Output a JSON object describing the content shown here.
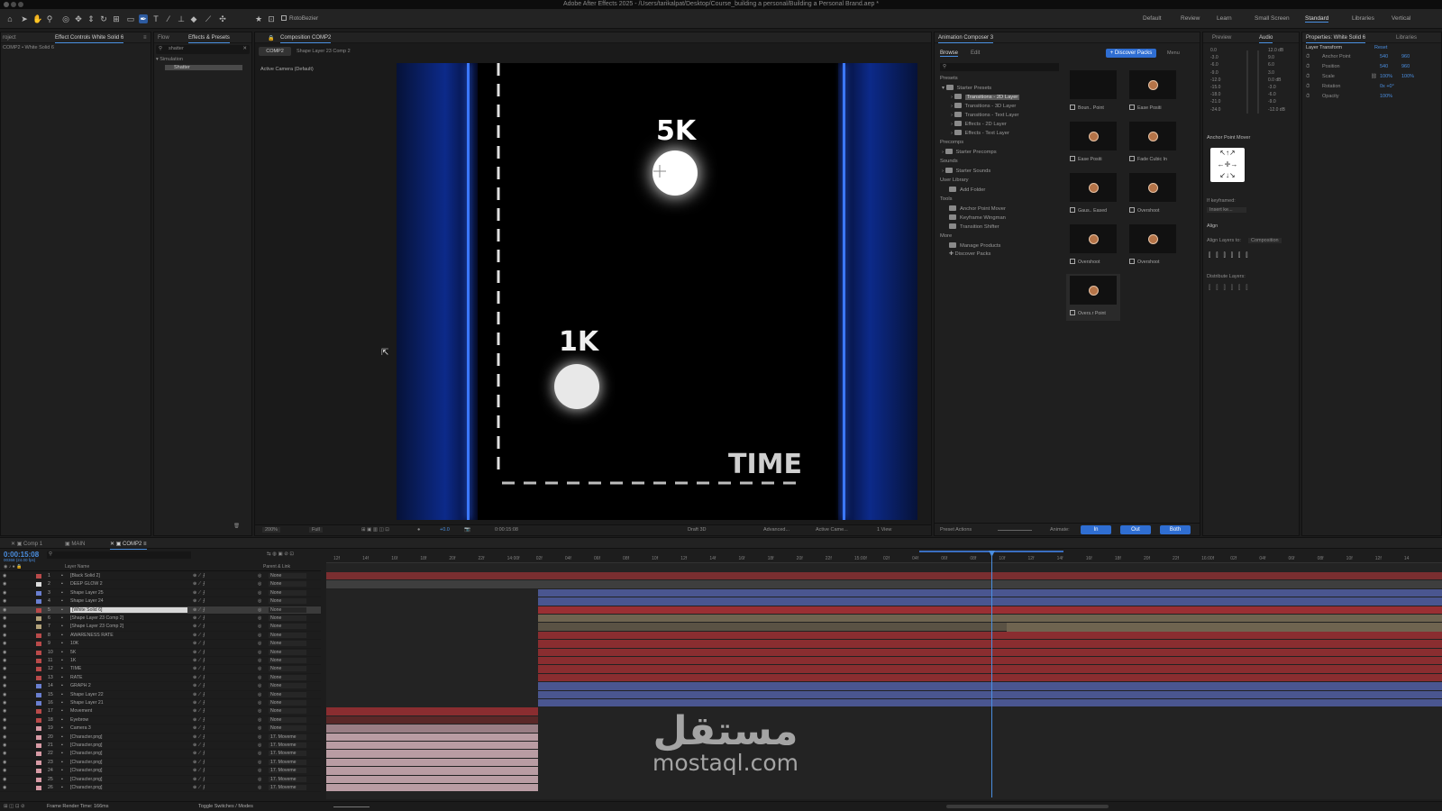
{
  "app": {
    "title": "Adobe After Effects 2025 - /Users/tarikalpat/Desktop/Course_building a personal/Building a Personal Brand.aep *"
  },
  "toolbar": {
    "rotobezier_label": "RotoBezier",
    "workspaces": [
      "Default",
      "Review",
      "Learn",
      "Small Screen",
      "Standard",
      "Libraries",
      "Vertical"
    ]
  },
  "project_panel": {
    "tab": "roject",
    "item": "COMP2 • White Solid 6"
  },
  "effect_controls": {
    "tab": "Effect Controls White Solid 6"
  },
  "effects_panel": {
    "tab_flow": "Flow",
    "tab": "Effects & Presets",
    "search": "shatter",
    "category": "Simulation",
    "result": "Shatter"
  },
  "composition": {
    "tab": "Composition COMP2",
    "breadcrumb_comp": "COMP2",
    "breadcrumb_layer": "Shape Layer 23 Comp 2",
    "camera_label": "Active Camera (Default)",
    "scene": {
      "label_top": "5K",
      "label_bottom": "1K",
      "label_axis": "TIME"
    },
    "footer": {
      "zoom": "200%",
      "resolution": "Full",
      "exposure": "+0.0",
      "timecode": "0:00:15:08",
      "renderer": "Draft 3D",
      "advanced": "Advanced...",
      "camera": "Active Came...",
      "view": "1 View"
    }
  },
  "animation_composer": {
    "title": "Animation Composer 3",
    "tab_browse": "Browse",
    "tab_edit": "Edit",
    "discover_btn": "+ Discover Packs",
    "menu": "Menu",
    "tree": [
      {
        "label": "Presets",
        "level": 0,
        "type": "header"
      },
      {
        "label": "Starter Presets",
        "level": 0,
        "type": "folder"
      },
      {
        "label": "Transitions - 2D Layer",
        "level": 1,
        "type": "folder",
        "selected": true
      },
      {
        "label": "Transitions - 3D Layer",
        "level": 1,
        "type": "folder"
      },
      {
        "label": "Transitions - Text Layer",
        "level": 1,
        "type": "folder"
      },
      {
        "label": "Effects - 2D Layer",
        "level": 1,
        "type": "folder"
      },
      {
        "label": "Effects - Text Layer",
        "level": 1,
        "type": "folder"
      },
      {
        "label": "Precomps",
        "level": 0,
        "type": "header"
      },
      {
        "label": "Starter Precomps",
        "level": 0,
        "type": "folder"
      },
      {
        "label": "Sounds",
        "level": 0,
        "type": "header"
      },
      {
        "label": "Starter Sounds",
        "level": 0,
        "type": "folder"
      },
      {
        "label": "User Library",
        "level": 0,
        "type": "header"
      },
      {
        "label": "Add Folder",
        "level": 0,
        "type": "link"
      },
      {
        "label": "Tools",
        "level": 0,
        "type": "header"
      },
      {
        "label": "Anchor Point Mover",
        "level": 0,
        "type": "link"
      },
      {
        "label": "Keyframe Wingman",
        "level": 0,
        "type": "link"
      },
      {
        "label": "Transition Shifter",
        "level": 0,
        "type": "link"
      },
      {
        "label": "More",
        "level": 0,
        "type": "header"
      },
      {
        "label": "Manage Products",
        "level": 0,
        "type": "link"
      },
      {
        "label": "Discover Packs",
        "level": 0,
        "type": "link"
      }
    ],
    "presets": [
      "Boun.. Point",
      "Ease Positi",
      "Ease Positi",
      "Fade Cubic In",
      "Gaus.. Eased",
      "Overshoot",
      "Overshoot",
      "Overshoot",
      "Overs.r Point"
    ],
    "preset_actions": "Preset Actions",
    "animate_label": "Animate:",
    "btn_in": "In",
    "btn_out": "Out",
    "btn_both": "Both"
  },
  "audio_panel": {
    "tab_preview": "Preview",
    "tab_audio": "Audio",
    "levels_left": [
      "0.0",
      "-3.0",
      "-6.0",
      "-9.0",
      "-12.0",
      "-15.0",
      "-18.0",
      "-21.0",
      "-24.0"
    ],
    "levels_right": [
      "12.0 dB",
      "9.0",
      "6.0",
      "3.0",
      "0.0 dB",
      "-3.0",
      "-6.0",
      "-9.0",
      "-12.0 dB"
    ]
  },
  "anchor_point_mover": {
    "title": "Anchor Point Mover",
    "if_keyframed": "If keyframed:",
    "insert_option": "Insert ke..."
  },
  "align_panel": {
    "title": "Align",
    "align_to_label": "Align Layers to:",
    "align_to": "Composition",
    "distribute_label": "Distribute Layers:"
  },
  "properties": {
    "title": "Properties: White Solid 6",
    "libraries_tab": "Libraries",
    "section": "Layer Transform",
    "reset": "Reset",
    "rows": [
      {
        "name": "Anchor Point",
        "v1": "540",
        "v2": "960"
      },
      {
        "name": "Position",
        "v1": "540",
        "v2": "960"
      },
      {
        "name": "Scale",
        "v1": "100%",
        "v2": "100%"
      },
      {
        "name": "Rotation",
        "v1": "0x +0°",
        "v2": ""
      },
      {
        "name": "Opacity",
        "v1": "100%",
        "v2": ""
      }
    ]
  },
  "timeline": {
    "tabs": [
      "Comp 1",
      "MAIN",
      "COMP2"
    ],
    "timecode": "0:00:15:08",
    "timecode_sub": "00368 (24.00 fps)",
    "col_layer_name": "Layer Name",
    "col_parent": "Parent & Link",
    "ruler": [
      "12f",
      "14f",
      "16f",
      "18f",
      "20f",
      "22f",
      "14:00f",
      "02f",
      "04f",
      "06f",
      "08f",
      "10f",
      "12f",
      "14f",
      "16f",
      "18f",
      "20f",
      "22f",
      "15:00f",
      "02f",
      "04f",
      "06f",
      "08f",
      "10f",
      "12f",
      "14f",
      "16f",
      "18f",
      "20f",
      "22f",
      "16:00f",
      "02f",
      "04f",
      "06f",
      "08f",
      "10f",
      "12f",
      "14"
    ],
    "layers": [
      {
        "num": "1",
        "name": "[Black Solid 2]",
        "color": "#b94a4a",
        "parent": "None"
      },
      {
        "num": "2",
        "name": "DEEP GLOW 2",
        "color": "#dddddd",
        "parent": "None"
      },
      {
        "num": "3",
        "name": "Shape Layer 25",
        "color": "#6a7fd0",
        "parent": "None"
      },
      {
        "num": "4",
        "name": "Shape Layer 24",
        "color": "#6a7fd0",
        "parent": "None"
      },
      {
        "num": "5",
        "name": "[White Solid 6]",
        "color": "#b94a4a",
        "parent": "None",
        "selected": true
      },
      {
        "num": "6",
        "name": "[Shape Layer 23 Comp 2]",
        "color": "#b3a27a",
        "parent": "None"
      },
      {
        "num": "7",
        "name": "[Shape Layer 23 Comp 2]",
        "color": "#b3a27a",
        "parent": "None"
      },
      {
        "num": "8",
        "name": "AWARENESS RATE",
        "color": "#b94a4a",
        "parent": "None"
      },
      {
        "num": "9",
        "name": "10K",
        "color": "#b94a4a",
        "parent": "None"
      },
      {
        "num": "10",
        "name": "5K",
        "color": "#b94a4a",
        "parent": "None"
      },
      {
        "num": "11",
        "name": "1K",
        "color": "#b94a4a",
        "parent": "None"
      },
      {
        "num": "12",
        "name": "TIME",
        "color": "#b94a4a",
        "parent": "None"
      },
      {
        "num": "13",
        "name": "RATE",
        "color": "#b94a4a",
        "parent": "None"
      },
      {
        "num": "14",
        "name": "GRAPH 2",
        "color": "#6a7fd0",
        "parent": "None"
      },
      {
        "num": "15",
        "name": "Shape Layer 22",
        "color": "#6a7fd0",
        "parent": "None"
      },
      {
        "num": "16",
        "name": "Shape Layer 21",
        "color": "#6a7fd0",
        "parent": "None"
      },
      {
        "num": "17",
        "name": "Movement",
        "color": "#b94a4a",
        "parent": "None"
      },
      {
        "num": "18",
        "name": "Eyebrow",
        "color": "#b94a4a",
        "parent": "None"
      },
      {
        "num": "19",
        "name": "Camera 3",
        "color": "#d79aa5",
        "parent": "None"
      },
      {
        "num": "20",
        "name": "[Character.png]",
        "color": "#d79aa5",
        "parent": "17. Moveme"
      },
      {
        "num": "21",
        "name": "[Character.png]",
        "color": "#d79aa5",
        "parent": "17. Moveme"
      },
      {
        "num": "22",
        "name": "[Character.png]",
        "color": "#d79aa5",
        "parent": "17. Moveme"
      },
      {
        "num": "23",
        "name": "[Character.png]",
        "color": "#d79aa5",
        "parent": "17. Moveme"
      },
      {
        "num": "24",
        "name": "[Character.png]",
        "color": "#d79aa5",
        "parent": "17. Moveme"
      },
      {
        "num": "25",
        "name": "[Character.png]",
        "color": "#d79aa5",
        "parent": "17. Moveme"
      },
      {
        "num": "26",
        "name": "[Character.png]",
        "color": "#d79aa5",
        "parent": "17. Moveme"
      }
    ],
    "footer_render": "Frame Render Time: 166ms",
    "footer_toggle": "Toggle Switches / Modes"
  },
  "watermark": {
    "arabic": "مستقل",
    "latin": "mostaql.com"
  }
}
